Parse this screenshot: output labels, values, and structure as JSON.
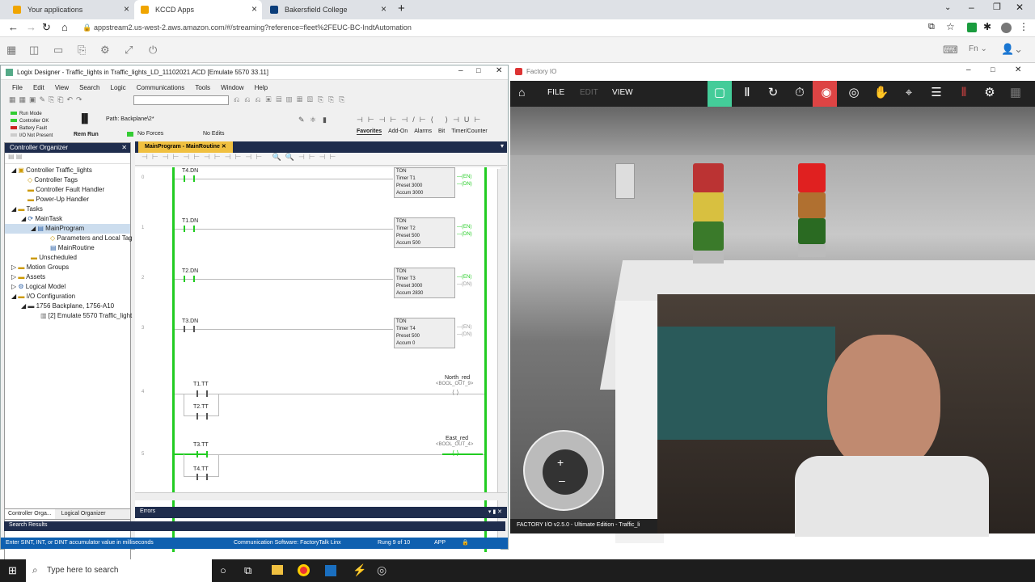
{
  "browser": {
    "tabs": [
      {
        "label": "Your applications"
      },
      {
        "label": "KCCD Apps"
      },
      {
        "label": "Bakersfield College"
      }
    ],
    "url": "appstream2.us-west-2.aws.amazon.com/#/streaming?reference=fleet%2FEUC-BC-IndtAutomation"
  },
  "logix": {
    "title": "Logix Designer - Traffic_lights in Traffic_lights_LD_11102021.ACD [Emulate 5570 33.11]",
    "menu": [
      "File",
      "Edit",
      "View",
      "Search",
      "Logic",
      "Communications",
      "Tools",
      "Window",
      "Help"
    ],
    "status_legend": [
      "Run Mode",
      "Controller OK",
      "Battery Fault",
      "I/O Not Present"
    ],
    "mode": "Rem Run",
    "path": "Path: Backplane\\2*",
    "forces": "No Forces",
    "edits": "No Edits",
    "instr_tabs": [
      "Favorites",
      "Add-On",
      "Alarms",
      "Bit",
      "Timer/Counter"
    ],
    "organizer_title": "Controller Organizer",
    "tree": [
      "Controller Traffic_lights",
      "Controller Tags",
      "Controller Fault Handler",
      "Power-Up Handler",
      "Tasks",
      "MainTask",
      "MainProgram",
      "Parameters and Local Tag",
      "MainRoutine",
      "Unscheduled",
      "Motion Groups",
      "Assets",
      "Logical Model",
      "I/O Configuration",
      "1756 Backplane, 1756-A10",
      "[2] Emulate 5570 Traffic_light"
    ],
    "routine_tab": "MainProgram - MainRoutine",
    "rungs": [
      {
        "num": "0",
        "contact": "T4.DN",
        "timer": "T1",
        "preset": "3000",
        "accum": "3000"
      },
      {
        "num": "1",
        "contact": "T1.DN",
        "timer": "T2",
        "preset": "500",
        "accum": "500"
      },
      {
        "num": "2",
        "contact": "T2.DN",
        "timer": "T3",
        "preset": "3000",
        "accum": "2830"
      },
      {
        "num": "3",
        "contact": "T3.DN",
        "timer": "T4",
        "preset": "500",
        "accum": "0"
      }
    ],
    "rung4": {
      "num": "4",
      "c1": "T1.TT",
      "c2": "T2.TT",
      "coil": "North_red",
      "coil_alias": "<BOOL_OUT_9>"
    },
    "rung5": {
      "num": "5",
      "c1": "T3.TT",
      "c2": "T4.TT",
      "coil": "East_red",
      "coil_alias": "<BOOL_OUT_4>"
    },
    "ton_labels": {
      "name": "TON",
      "timer": "Timer",
      "preset": "Preset",
      "accum": "Accum",
      "en": "EN",
      "dn": "DN"
    },
    "bottom_tabs": [
      "Controller Orga...",
      "Logical Organizer"
    ],
    "errors": "Errors",
    "search_results": "Search Results",
    "status": "Enter SINT, INT, or DINT accumulator value in milliseconds",
    "comm": "Communication Software: FactoryTalk Linx",
    "rung_info": "Rung 9 of 10",
    "app": "APP"
  },
  "factoryio": {
    "title": "Factory IO",
    "menu": [
      "FILE",
      "EDIT",
      "VIEW"
    ],
    "footer": "FACTORY I/O v2.5.0 - Ultimate Edition - Traffic_li"
  },
  "taskbar": {
    "search_placeholder": "Type here to search"
  }
}
